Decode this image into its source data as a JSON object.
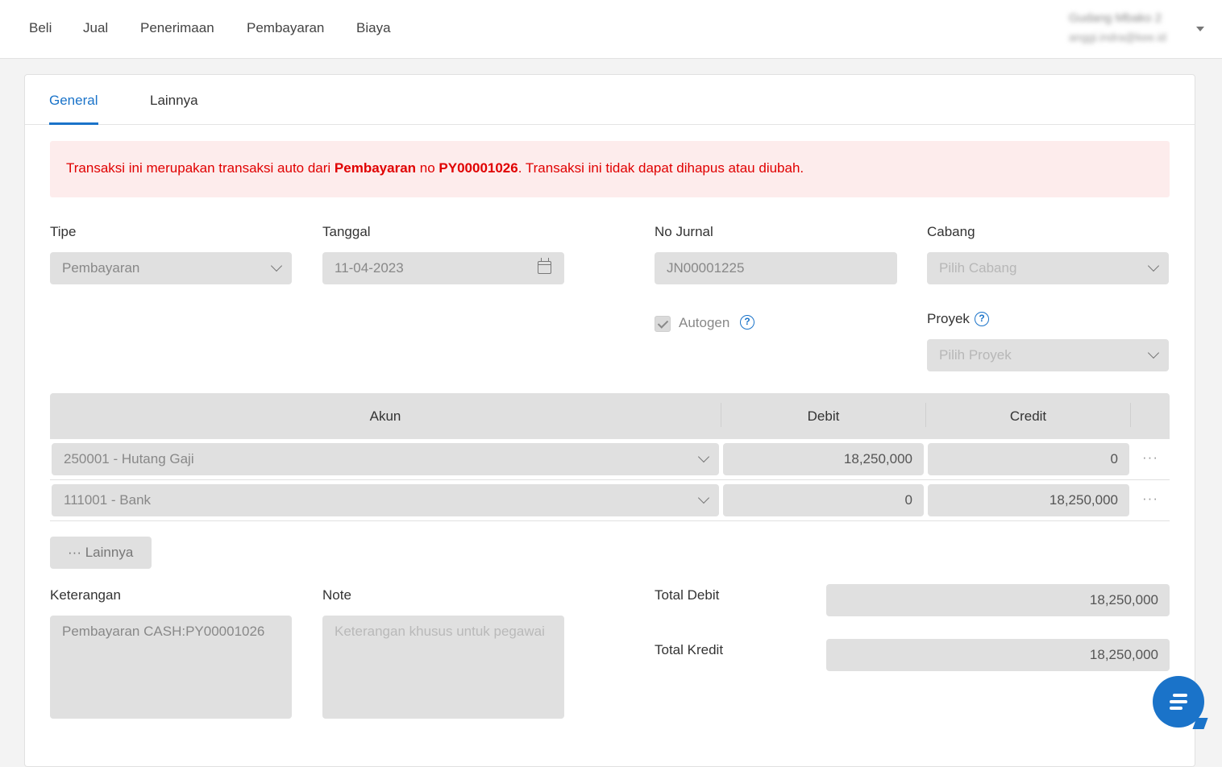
{
  "nav": {
    "items": [
      "Beli",
      "Jual",
      "Penerimaan",
      "Pembayaran",
      "Biaya"
    ],
    "user_name": "Gudang Mbako 2",
    "user_email": "anggi.indra@kee.id"
  },
  "tabs": [
    "General",
    "Lainnya"
  ],
  "alert": {
    "prefix": "Transaksi ini merupakan transaksi auto dari ",
    "source": "Pembayaran",
    "middle": " no ",
    "number": "PY00001026",
    "suffix": ". Transaksi ini tidak dapat dihapus atau diubah."
  },
  "form": {
    "tipe_label": "Tipe",
    "tipe_value": "Pembayaran",
    "tanggal_label": "Tanggal",
    "tanggal_value": "11-04-2023",
    "no_jurnal_label": "No Jurnal",
    "no_jurnal_value": "JN00001225",
    "autogen_label": "Autogen",
    "cabang_label": "Cabang",
    "cabang_placeholder": "Pilih Cabang",
    "proyek_label": "Proyek",
    "proyek_placeholder": "Pilih Proyek"
  },
  "table": {
    "headers": [
      "Akun",
      "Debit",
      "Credit"
    ],
    "rows": [
      {
        "akun": "250001 - Hutang Gaji",
        "debit": "18,250,000",
        "credit": "0"
      },
      {
        "akun": "111001 - Bank",
        "debit": "0",
        "credit": "18,250,000"
      }
    ],
    "more_button": "Lainnya"
  },
  "footer": {
    "keterangan_label": "Keterangan",
    "keterangan_value": "Pembayaran CASH:PY00001026",
    "note_label": "Note",
    "note_placeholder": "Keterangan khusus untuk pegawai",
    "total_debit_label": "Total Debit",
    "total_debit_value": "18,250,000",
    "total_kredit_label": "Total Kredit",
    "total_kredit_value": "18,250,000"
  },
  "help_glyph": "?",
  "dots_glyph": "···",
  "icons": {
    "calendar": "calendar-icon",
    "chevron": "chevron-down-icon",
    "chat": "chat-icon",
    "help": "help-circle-icon"
  },
  "colors": {
    "accent": "#1a73c9",
    "alert_text": "#e00000",
    "alert_bg": "#fdecec",
    "field_bg": "#e0e0e0"
  }
}
